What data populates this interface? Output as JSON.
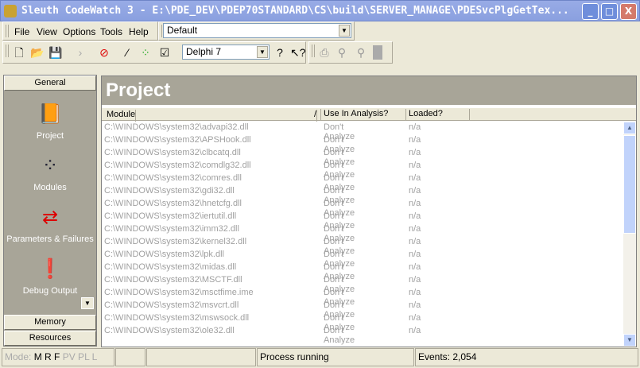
{
  "window": {
    "title": "Sleuth CodeWatch 3 - E:\\PDE_DEV\\PDEP70STANDARD\\CS\\build\\SERVER_MANAGE\\PDESvcPlgGetTex...",
    "min": "_",
    "max": "□",
    "close": "X"
  },
  "menu": [
    "File",
    "View",
    "Options",
    "Tools",
    "Help"
  ],
  "profile_combo": "Default",
  "compiler_combo": "Delphi 7",
  "sidebar": {
    "top_button": "General",
    "items": [
      "Project",
      "Modules",
      "Parameters & Failures",
      "Debug Output"
    ],
    "bottom_buttons": [
      "Memory",
      "Resources"
    ]
  },
  "main": {
    "title": "Project",
    "columns": [
      "Module",
      "Use In Analysis?",
      "Loaded?"
    ],
    "sort_indicator": "/",
    "rows": [
      [
        "C:\\WINDOWS\\system32\\advapi32.dll",
        "Don't Analyze",
        "n/a"
      ],
      [
        "C:\\WINDOWS\\system32\\APSHook.dll",
        "Don't Analyze",
        "n/a"
      ],
      [
        "C:\\WINDOWS\\system32\\clbcatq.dll",
        "Don't Analyze",
        "n/a"
      ],
      [
        "C:\\WINDOWS\\system32\\comdlg32.dll",
        "Don't Analyze",
        "n/a"
      ],
      [
        "C:\\WINDOWS\\system32\\comres.dll",
        "Don't Analyze",
        "n/a"
      ],
      [
        "C:\\WINDOWS\\system32\\gdi32.dll",
        "Don't Analyze",
        "n/a"
      ],
      [
        "C:\\WINDOWS\\system32\\hnetcfg.dll",
        "Don't Analyze",
        "n/a"
      ],
      [
        "C:\\WINDOWS\\system32\\iertutil.dll",
        "Don't Analyze",
        "n/a"
      ],
      [
        "C:\\WINDOWS\\system32\\imm32.dll",
        "Don't Analyze",
        "n/a"
      ],
      [
        "C:\\WINDOWS\\system32\\kernel32.dll",
        "Don't Analyze",
        "n/a"
      ],
      [
        "C:\\WINDOWS\\system32\\lpk.dll",
        "Don't Analyze",
        "n/a"
      ],
      [
        "C:\\WINDOWS\\system32\\midas.dll",
        "Don't Analyze",
        "n/a"
      ],
      [
        "C:\\WINDOWS\\system32\\MSCTF.dll",
        "Don't Analyze",
        "n/a"
      ],
      [
        "C:\\WINDOWS\\system32\\msctfime.ime",
        "Don't Analyze",
        "n/a"
      ],
      [
        "C:\\WINDOWS\\system32\\msvcrt.dll",
        "Don't Analyze",
        "n/a"
      ],
      [
        "C:\\WINDOWS\\system32\\mswsock.dll",
        "Don't Analyze",
        "n/a"
      ],
      [
        "C:\\WINDOWS\\system32\\ole32.dll",
        "Don't Analyze",
        "n/a"
      ]
    ]
  },
  "status": {
    "mode_label": "Mode:",
    "mode_active": "M R F",
    "mode_inactive": "PV PL L",
    "process": "Process running",
    "events": "Events: 2,054"
  }
}
